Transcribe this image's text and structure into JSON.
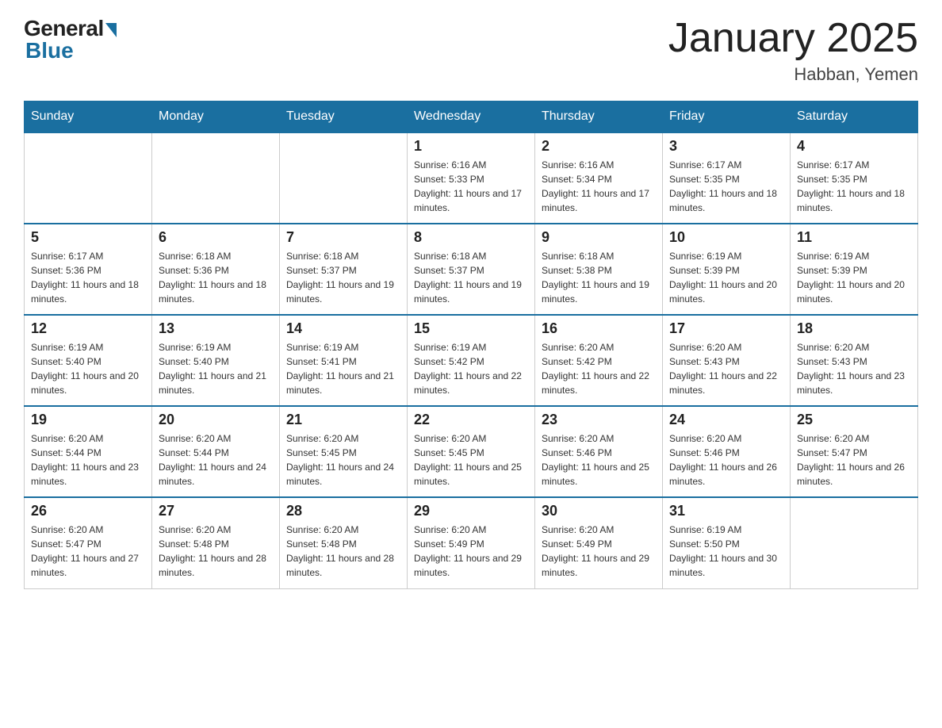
{
  "header": {
    "logo_general": "General",
    "logo_blue": "Blue",
    "month_title": "January 2025",
    "location": "Habban, Yemen"
  },
  "weekdays": [
    "Sunday",
    "Monday",
    "Tuesday",
    "Wednesday",
    "Thursday",
    "Friday",
    "Saturday"
  ],
  "weeks": [
    [
      {
        "day": "",
        "sunrise": "",
        "sunset": "",
        "daylight": ""
      },
      {
        "day": "",
        "sunrise": "",
        "sunset": "",
        "daylight": ""
      },
      {
        "day": "",
        "sunrise": "",
        "sunset": "",
        "daylight": ""
      },
      {
        "day": "1",
        "sunrise": "Sunrise: 6:16 AM",
        "sunset": "Sunset: 5:33 PM",
        "daylight": "Daylight: 11 hours and 17 minutes."
      },
      {
        "day": "2",
        "sunrise": "Sunrise: 6:16 AM",
        "sunset": "Sunset: 5:34 PM",
        "daylight": "Daylight: 11 hours and 17 minutes."
      },
      {
        "day": "3",
        "sunrise": "Sunrise: 6:17 AM",
        "sunset": "Sunset: 5:35 PM",
        "daylight": "Daylight: 11 hours and 18 minutes."
      },
      {
        "day": "4",
        "sunrise": "Sunrise: 6:17 AM",
        "sunset": "Sunset: 5:35 PM",
        "daylight": "Daylight: 11 hours and 18 minutes."
      }
    ],
    [
      {
        "day": "5",
        "sunrise": "Sunrise: 6:17 AM",
        "sunset": "Sunset: 5:36 PM",
        "daylight": "Daylight: 11 hours and 18 minutes."
      },
      {
        "day": "6",
        "sunrise": "Sunrise: 6:18 AM",
        "sunset": "Sunset: 5:36 PM",
        "daylight": "Daylight: 11 hours and 18 minutes."
      },
      {
        "day": "7",
        "sunrise": "Sunrise: 6:18 AM",
        "sunset": "Sunset: 5:37 PM",
        "daylight": "Daylight: 11 hours and 19 minutes."
      },
      {
        "day": "8",
        "sunrise": "Sunrise: 6:18 AM",
        "sunset": "Sunset: 5:37 PM",
        "daylight": "Daylight: 11 hours and 19 minutes."
      },
      {
        "day": "9",
        "sunrise": "Sunrise: 6:18 AM",
        "sunset": "Sunset: 5:38 PM",
        "daylight": "Daylight: 11 hours and 19 minutes."
      },
      {
        "day": "10",
        "sunrise": "Sunrise: 6:19 AM",
        "sunset": "Sunset: 5:39 PM",
        "daylight": "Daylight: 11 hours and 20 minutes."
      },
      {
        "day": "11",
        "sunrise": "Sunrise: 6:19 AM",
        "sunset": "Sunset: 5:39 PM",
        "daylight": "Daylight: 11 hours and 20 minutes."
      }
    ],
    [
      {
        "day": "12",
        "sunrise": "Sunrise: 6:19 AM",
        "sunset": "Sunset: 5:40 PM",
        "daylight": "Daylight: 11 hours and 20 minutes."
      },
      {
        "day": "13",
        "sunrise": "Sunrise: 6:19 AM",
        "sunset": "Sunset: 5:40 PM",
        "daylight": "Daylight: 11 hours and 21 minutes."
      },
      {
        "day": "14",
        "sunrise": "Sunrise: 6:19 AM",
        "sunset": "Sunset: 5:41 PM",
        "daylight": "Daylight: 11 hours and 21 minutes."
      },
      {
        "day": "15",
        "sunrise": "Sunrise: 6:19 AM",
        "sunset": "Sunset: 5:42 PM",
        "daylight": "Daylight: 11 hours and 22 minutes."
      },
      {
        "day": "16",
        "sunrise": "Sunrise: 6:20 AM",
        "sunset": "Sunset: 5:42 PM",
        "daylight": "Daylight: 11 hours and 22 minutes."
      },
      {
        "day": "17",
        "sunrise": "Sunrise: 6:20 AM",
        "sunset": "Sunset: 5:43 PM",
        "daylight": "Daylight: 11 hours and 22 minutes."
      },
      {
        "day": "18",
        "sunrise": "Sunrise: 6:20 AM",
        "sunset": "Sunset: 5:43 PM",
        "daylight": "Daylight: 11 hours and 23 minutes."
      }
    ],
    [
      {
        "day": "19",
        "sunrise": "Sunrise: 6:20 AM",
        "sunset": "Sunset: 5:44 PM",
        "daylight": "Daylight: 11 hours and 23 minutes."
      },
      {
        "day": "20",
        "sunrise": "Sunrise: 6:20 AM",
        "sunset": "Sunset: 5:44 PM",
        "daylight": "Daylight: 11 hours and 24 minutes."
      },
      {
        "day": "21",
        "sunrise": "Sunrise: 6:20 AM",
        "sunset": "Sunset: 5:45 PM",
        "daylight": "Daylight: 11 hours and 24 minutes."
      },
      {
        "day": "22",
        "sunrise": "Sunrise: 6:20 AM",
        "sunset": "Sunset: 5:45 PM",
        "daylight": "Daylight: 11 hours and 25 minutes."
      },
      {
        "day": "23",
        "sunrise": "Sunrise: 6:20 AM",
        "sunset": "Sunset: 5:46 PM",
        "daylight": "Daylight: 11 hours and 25 minutes."
      },
      {
        "day": "24",
        "sunrise": "Sunrise: 6:20 AM",
        "sunset": "Sunset: 5:46 PM",
        "daylight": "Daylight: 11 hours and 26 minutes."
      },
      {
        "day": "25",
        "sunrise": "Sunrise: 6:20 AM",
        "sunset": "Sunset: 5:47 PM",
        "daylight": "Daylight: 11 hours and 26 minutes."
      }
    ],
    [
      {
        "day": "26",
        "sunrise": "Sunrise: 6:20 AM",
        "sunset": "Sunset: 5:47 PM",
        "daylight": "Daylight: 11 hours and 27 minutes."
      },
      {
        "day": "27",
        "sunrise": "Sunrise: 6:20 AM",
        "sunset": "Sunset: 5:48 PM",
        "daylight": "Daylight: 11 hours and 28 minutes."
      },
      {
        "day": "28",
        "sunrise": "Sunrise: 6:20 AM",
        "sunset": "Sunset: 5:48 PM",
        "daylight": "Daylight: 11 hours and 28 minutes."
      },
      {
        "day": "29",
        "sunrise": "Sunrise: 6:20 AM",
        "sunset": "Sunset: 5:49 PM",
        "daylight": "Daylight: 11 hours and 29 minutes."
      },
      {
        "day": "30",
        "sunrise": "Sunrise: 6:20 AM",
        "sunset": "Sunset: 5:49 PM",
        "daylight": "Daylight: 11 hours and 29 minutes."
      },
      {
        "day": "31",
        "sunrise": "Sunrise: 6:19 AM",
        "sunset": "Sunset: 5:50 PM",
        "daylight": "Daylight: 11 hours and 30 minutes."
      },
      {
        "day": "",
        "sunrise": "",
        "sunset": "",
        "daylight": ""
      }
    ]
  ]
}
